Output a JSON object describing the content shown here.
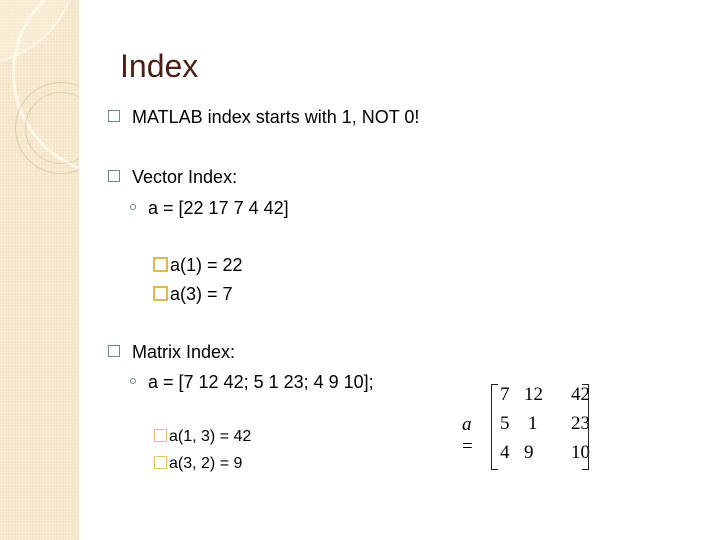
{
  "slide": {
    "title": "Index",
    "bullets": [
      {
        "text": "MATLAB index starts with 1, NOT 0!"
      },
      {
        "text": "Vector Index:",
        "sub": "a = [22 17 7 4 42]",
        "examples": [
          "a(1) = 22",
          "a(3) = 7"
        ]
      },
      {
        "text": "Matrix Index:",
        "sub": "a = [7 12 42; 5 1 23; 4 9 10];",
        "examples": [
          "a(1, 3) = 42",
          "a(3, 2) = 9"
        ]
      }
    ],
    "matrix_figure": {
      "lhs": "a",
      "eq": "=",
      "rows": [
        [
          "7",
          "12",
          "42"
        ],
        [
          "5",
          "1",
          "23"
        ],
        [
          "4",
          "9",
          "10"
        ]
      ]
    }
  }
}
